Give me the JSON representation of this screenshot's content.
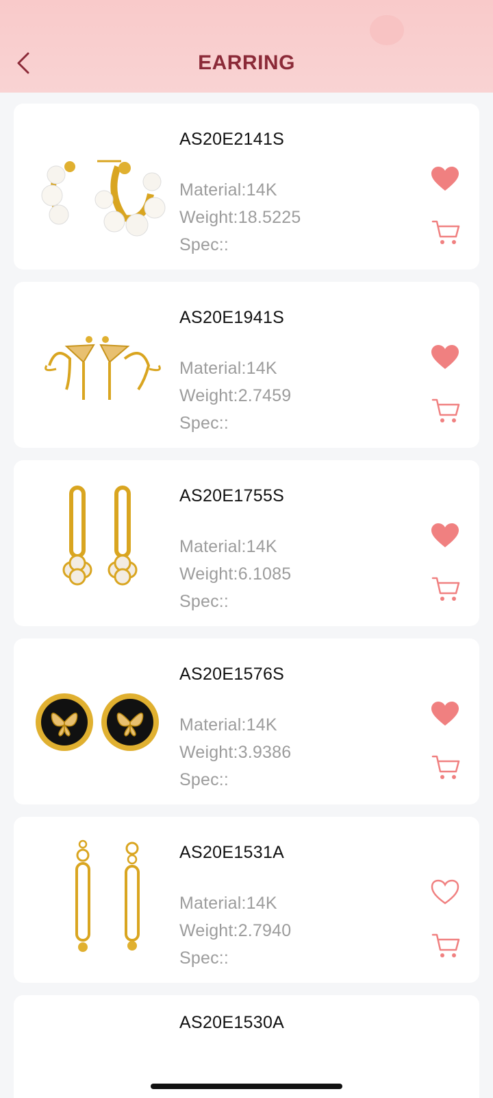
{
  "header": {
    "title": "EARRING",
    "accent": "#8b2a38",
    "background": "#f9caca",
    "back_icon": "chevron-left-icon"
  },
  "products": [
    {
      "code": "AS20E2141S",
      "material": "Material:14K",
      "weight": "Weight:18.5225",
      "spec": "Spec::",
      "favorited": true
    },
    {
      "code": "AS20E1941S",
      "material": "Material:14K",
      "weight": "Weight:2.7459",
      "spec": "Spec::",
      "favorited": true
    },
    {
      "code": "AS20E1755S",
      "material": "Material:14K",
      "weight": "Weight:6.1085",
      "spec": "Spec::",
      "favorited": true
    },
    {
      "code": "AS20E1576S",
      "material": "Material:14K",
      "weight": "Weight:3.9386",
      "spec": "Spec::",
      "favorited": true
    },
    {
      "code": "AS20E1531A",
      "material": "Material:14K",
      "weight": "Weight:2.7940",
      "spec": "Spec::",
      "favorited": false
    },
    {
      "code": "AS20E1530A"
    }
  ],
  "icons": {
    "favorite": "heart-icon",
    "cart": "cart-icon"
  },
  "colors": {
    "icon_pink": "#f08080",
    "code_text": "#111111",
    "spec_text": "#9c9c9c"
  }
}
